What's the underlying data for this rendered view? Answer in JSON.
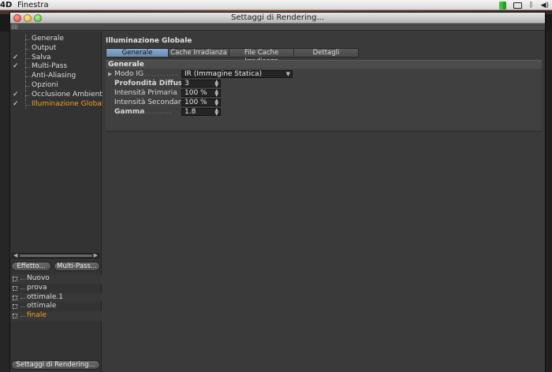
{
  "menubar": {
    "app": "4D",
    "menu": "Finestra"
  },
  "window": {
    "title": "Settaggi di Rendering..."
  },
  "sidebar": {
    "items": [
      {
        "label": "Generale",
        "checked": false,
        "active": false
      },
      {
        "label": "Output",
        "checked": false,
        "active": false
      },
      {
        "label": "Salva",
        "checked": true,
        "active": false
      },
      {
        "label": "Multi-Pass",
        "checked": true,
        "active": false
      },
      {
        "label": "Anti-Aliasing",
        "checked": false,
        "active": false
      },
      {
        "label": "Opzioni",
        "checked": false,
        "active": false
      },
      {
        "label": "Occlusione Ambientale",
        "checked": true,
        "active": false
      },
      {
        "label": "Illuminazione Globale",
        "checked": true,
        "active": true
      }
    ],
    "check_glyph": "✓",
    "effetto_button": "Effetto...",
    "multipass_button": "Multi-Pass...",
    "settings_list": [
      {
        "label": "Nuovo",
        "active": false
      },
      {
        "label": "prova",
        "active": false
      },
      {
        "label": "ottimale.1",
        "active": false
      },
      {
        "label": "ottimale",
        "active": false
      },
      {
        "label": "finale",
        "active": true
      }
    ],
    "settaggi_button": "Settaggi di Rendering..."
  },
  "main": {
    "section_title": "Illuminazione Globale",
    "tabs": [
      {
        "label": "Generale",
        "active": true
      },
      {
        "label": "Cache Irradianza",
        "active": false
      },
      {
        "label": "File Cache Irradianza",
        "active": false
      },
      {
        "label": "Dettagli",
        "active": false
      }
    ],
    "group_title": "Generale",
    "fields": {
      "modo_ig": {
        "label": "Modo IG",
        "dots": ".............",
        "value": "IR (Immagine Statica)"
      },
      "profondita": {
        "label": "Profondità Diffusione",
        "value": "3"
      },
      "intensita_primaria": {
        "label": "Intensità Primaria",
        "dots": ".....",
        "value": "100 %"
      },
      "intensita_secondaria": {
        "label": "Intensità Secondaria",
        "dots": "..",
        "value": "100 %"
      },
      "gamma": {
        "label": "Gamma",
        "dots": "...........",
        "value": "1.8"
      }
    }
  },
  "colors": {
    "accent_active": "#f0a020",
    "tab_active": "#7a9ac0",
    "panel": "#3a3a3a"
  }
}
